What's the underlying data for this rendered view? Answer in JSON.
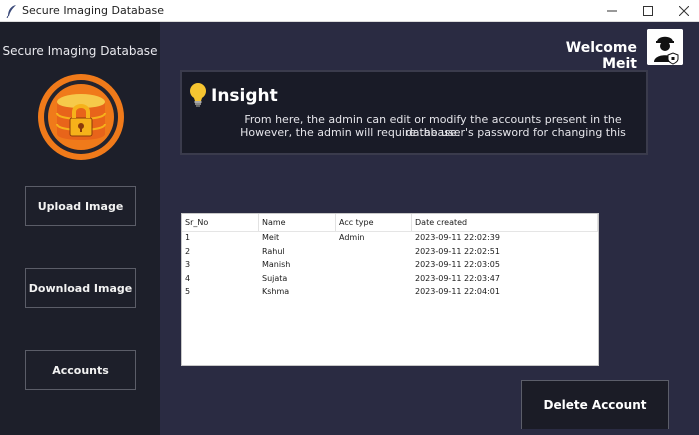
{
  "window": {
    "title": "Secure Imaging Database"
  },
  "sidebar": {
    "title": "Secure Imaging Database",
    "buttons": {
      "upload": "Upload Image",
      "download": "Download Image",
      "accounts": "Accounts"
    }
  },
  "header": {
    "welcome": "Welcome Meit"
  },
  "insight": {
    "heading": "Insight",
    "line1": "From here, the admin can edit or modify the accounts present in the database.",
    "line2": "However, the admin will require the user's password for changing this"
  },
  "table": {
    "columns": [
      "Sr_No",
      "Name",
      "Acc type",
      "Date created"
    ],
    "rows": [
      [
        "1",
        "Meit",
        "Admin",
        "2023-09-11 22:02:39"
      ],
      [
        "2",
        "Rahul",
        "",
        "2023-09-11 22:02:51"
      ],
      [
        "3",
        "Manish",
        "",
        "2023-09-11 22:03:05"
      ],
      [
        "4",
        "Sujata",
        "",
        "2023-09-11 22:03:47"
      ],
      [
        "5",
        "Kshma",
        "",
        "2023-09-11 22:04:01"
      ]
    ]
  },
  "actions": {
    "delete": "Delete Account"
  },
  "colors": {
    "background": "#2a2b42",
    "sidebar": "#1d1f2a",
    "panel": "#191b27",
    "accent_orange": "#f07a1a",
    "accent_gold": "#f6b21a"
  }
}
